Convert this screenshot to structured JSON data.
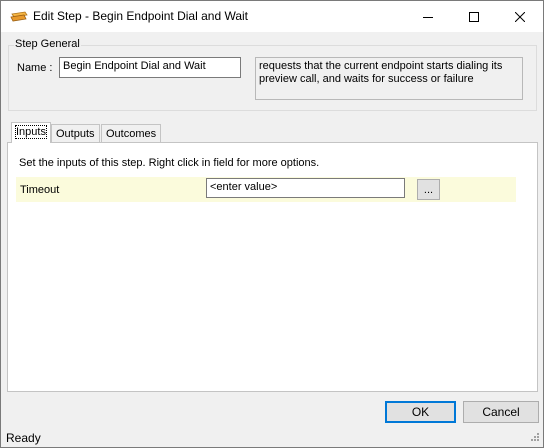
{
  "window": {
    "title": "Edit Step - Begin Endpoint Dial and Wait",
    "icon": "step-icon"
  },
  "title_buttons": {
    "minimize_icon": "minimize-icon",
    "maximize_icon": "maximize-icon",
    "close_icon": "close-icon"
  },
  "step_general": {
    "legend": "Step General",
    "name_label": "Name :",
    "name_value": "Begin Endpoint Dial and Wait",
    "description": "requests that the current endpoint starts dialing its preview call, and waits for success or failure"
  },
  "tabs": [
    {
      "label": "Inputs",
      "active": true
    },
    {
      "label": "Outputs",
      "active": false
    },
    {
      "label": "Outcomes",
      "active": false
    }
  ],
  "inputs_panel": {
    "hint": "Set the inputs of this step.  Right click in field for more options.",
    "rows": [
      {
        "label": "Timeout",
        "value": "<enter value>",
        "button": "..."
      }
    ]
  },
  "footer": {
    "ok_label": "OK",
    "cancel_label": "Cancel"
  },
  "status": {
    "text": "Ready"
  },
  "colors": {
    "input_row_background": "#fbfbdc",
    "default_button_border": "#0078d7"
  }
}
